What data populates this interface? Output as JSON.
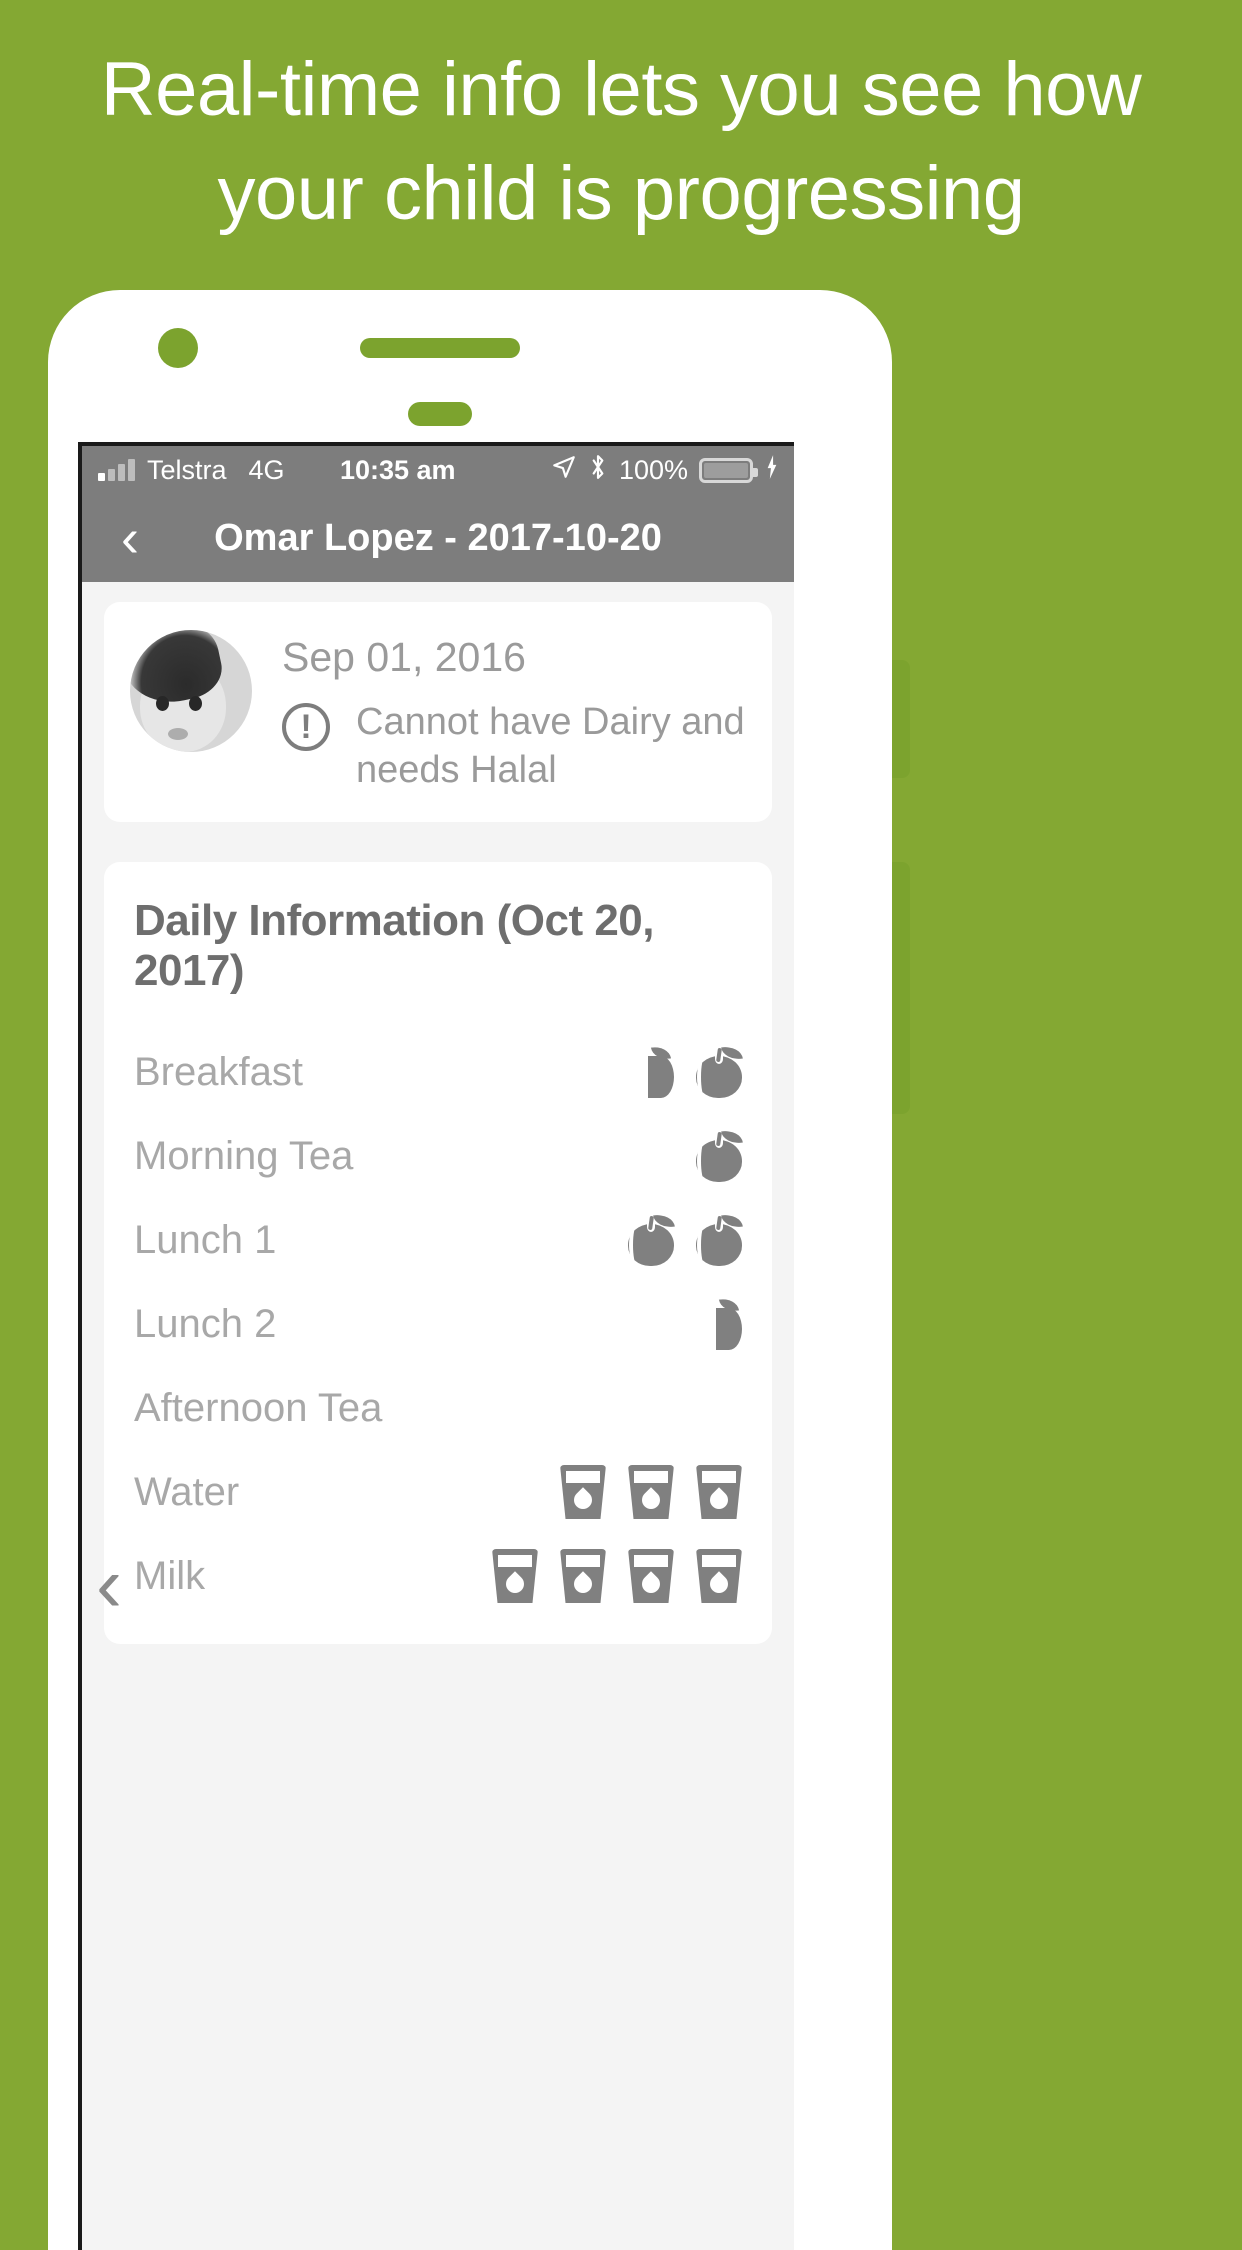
{
  "promo": {
    "line1": "Real-time info lets you see how",
    "line2": "your child is progressing",
    "background_color": "#84a833",
    "text_color": "#ffffff"
  },
  "status_bar": {
    "carrier": "Telstra",
    "network": "4G",
    "time": "10:35 am",
    "battery_percent": "100%",
    "icons": [
      "signal-bars-icon",
      "location-arrow-icon",
      "bluetooth-icon",
      "battery-icon",
      "charging-bolt-icon"
    ]
  },
  "nav_bar": {
    "back_label": "‹",
    "title": "Omar Lopez - 2017-10-20",
    "background_color": "#7d7d7d"
  },
  "profile": {
    "dob": "Sep 01, 2016",
    "warning_symbol": "!",
    "allergy_note": "Cannot have Dairy and needs Halal"
  },
  "daily_information": {
    "title": "Daily Information (Oct 20, 2017)",
    "rows": [
      {
        "label": "Breakfast",
        "icons": [
          "half-apple-icon",
          "apple-icon"
        ]
      },
      {
        "label": "Morning Tea",
        "icons": [
          "apple-icon"
        ]
      },
      {
        "label": "Lunch 1",
        "icons": [
          "apple-icon",
          "apple-icon"
        ]
      },
      {
        "label": "Lunch 2",
        "icons": [
          "half-apple-icon"
        ]
      },
      {
        "label": "Afternoon Tea",
        "icons": []
      },
      {
        "label": "Water",
        "icons": [
          "glass-icon",
          "glass-icon",
          "glass-icon"
        ]
      },
      {
        "label": "Milk",
        "icons": [
          "glass-icon",
          "glass-icon",
          "glass-icon",
          "glass-icon"
        ]
      }
    ]
  },
  "page_chevron": "‹"
}
